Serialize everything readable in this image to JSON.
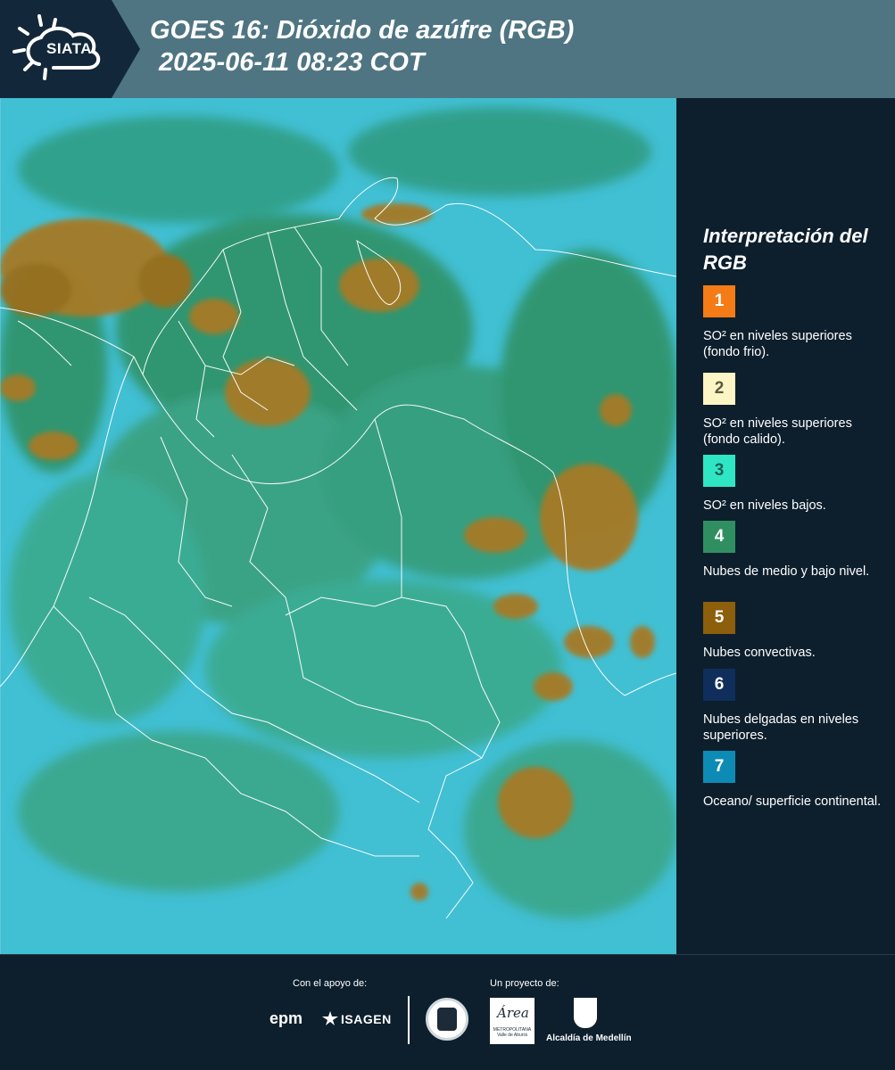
{
  "header": {
    "logo_text": "SIATA",
    "title_line1": "GOES 16: Dióxido de azúfre (RGB)",
    "title_line2": "2025-06-11 08:23 COT"
  },
  "legend": {
    "title": "Interpretación del RGB",
    "items": [
      {
        "number": "1",
        "color": "#f47b16",
        "label": "SO² en niveles superiores (fondo frio)."
      },
      {
        "number": "2",
        "color": "#fcf6c5",
        "label": "SO² en niveles superiores (fondo calido)."
      },
      {
        "number": "3",
        "color": "#2ee6c3",
        "label": "SO² en niveles bajos."
      },
      {
        "number": "4",
        "color": "#2f8f61",
        "label": "Nubes de medio y bajo nivel."
      },
      {
        "number": "5",
        "color": "#8d5e0b",
        "label": "Nubes convectivas."
      },
      {
        "number": "6",
        "color": "#0f2e5c",
        "label": "Nubes delgadas en niveles superiores."
      },
      {
        "number": "7",
        "color": "#0e8bb4",
        "label": "Oceano/ superficie continental."
      }
    ]
  },
  "footer": {
    "support_label": "Con el apoyo de:",
    "project_label": "Un proyecto de:",
    "sponsor_1": "epm",
    "sponsor_2": "ISAGEN",
    "partner_area": "Área",
    "partner_area_sub": "METROPOLITANA Valle de Aburrá",
    "partner_alcaldia": "Alcaldía de Medellín"
  }
}
